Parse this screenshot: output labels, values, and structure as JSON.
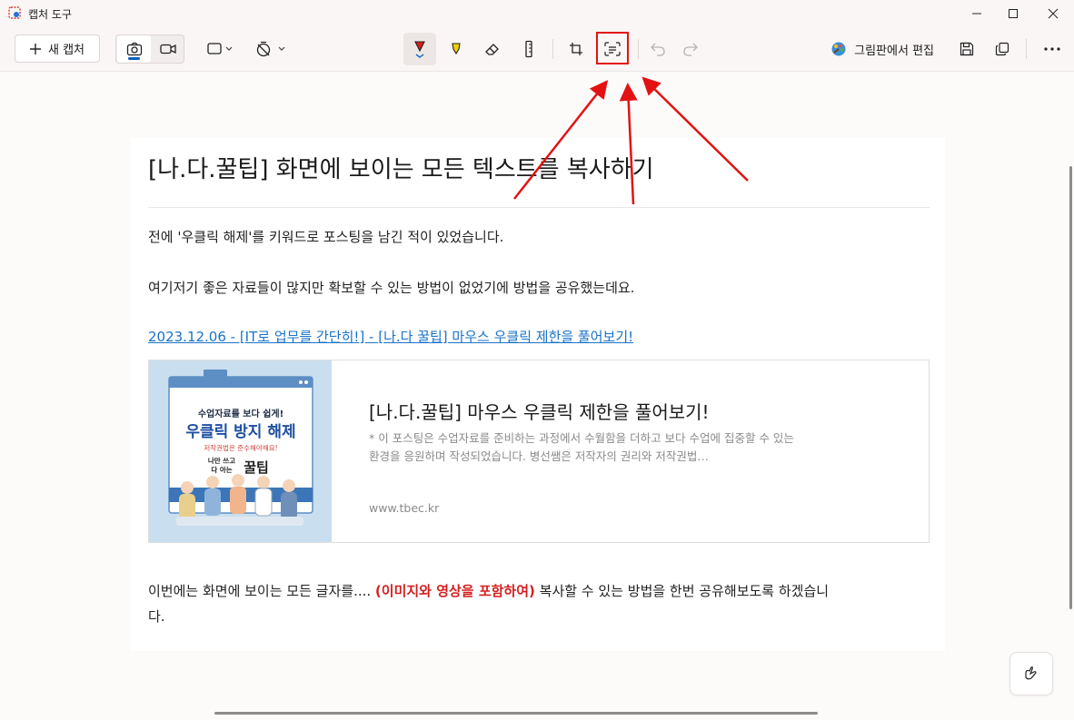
{
  "window": {
    "title": "캡처 도구"
  },
  "toolbar": {
    "new_capture_label": "새 캡처",
    "paint_edit_label": "그림판에서 편집",
    "icons": [
      "camera-icon",
      "video-icon",
      "snip-mode-icon",
      "timer-icon",
      "ballpoint-pen-icon",
      "highlighter-icon",
      "eraser-icon",
      "ruler-icon",
      "crop-icon",
      "text-actions-icon",
      "undo-icon",
      "redo-icon",
      "paint-icon",
      "save-icon",
      "copy-icon",
      "more-icon"
    ]
  },
  "document": {
    "title": "[나.다.꿀팁] 화면에 보이는 모든 텍스트를 복사하기",
    "para1": "전에 '우클릭 해제'를 키워드로 포스팅을 남긴 적이 있었습니다.",
    "para2": "여기저기 좋은 자료들이 많지만 확보할 수 있는 방법이 없었기에 방법을 공유했는데요.",
    "link": "2023.12.06 - [IT로 업무를 간단히!] - [나.다 꿀팁] 마우스 우클릭 제한을 풀어보기!",
    "card": {
      "title": "[나.다.꿀팁] 마우스 우클릭 제한을 풀어보기!",
      "description": "* 이 포스팅은 수업자료를 준비하는 과정에서 수월함을 더하고 보다 수업에 집중할 수 있는 환경을 응원하며 작성되었습니다. 병선쌤은 저작자의 권리와 저작권법…",
      "url": "www.tbec.kr",
      "thumb_line1": "수업자료를 보다 쉽게!",
      "thumb_line2": "우클릭 방지 해제",
      "thumb_line3": "저작권법은 준수해야해요!",
      "thumb_brand_a": "나만 쓰고",
      "thumb_brand_b": "다 아는",
      "thumb_brand_c": "꿀팁"
    },
    "para3_prefix": "이번에는 화면에 보이는 모든 글자를.... ",
    "para3_emph": "(이미지와 영상을 포함하여)",
    "para3_suffix": " 복사할 수 있는 방법을 한번 공유해보도록 하겠습니",
    "para3_wrap": "다."
  },
  "colors": {
    "accent": "#0a5dc2",
    "annotation": "#e31212",
    "link": "#1a73c8",
    "emphasis": "#d32020"
  }
}
